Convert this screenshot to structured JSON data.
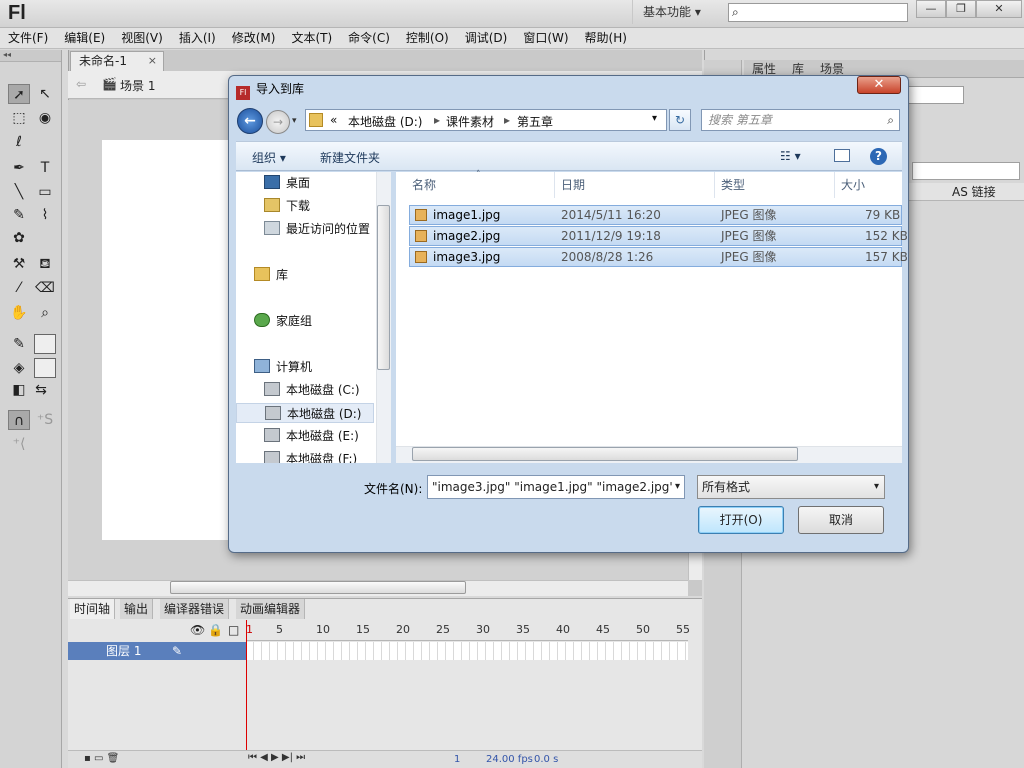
{
  "app": {
    "logo": "Fl",
    "workspace": "基本功能 ▾",
    "search_placeholder": "",
    "win_buttons": [
      "—",
      "❐",
      "✕"
    ]
  },
  "menu": [
    "文件(F)",
    "编辑(E)",
    "视图(V)",
    "插入(I)",
    "修改(M)",
    "文本(T)",
    "命令(C)",
    "控制(O)",
    "调试(D)",
    "窗口(W)",
    "帮助(H)"
  ],
  "document": {
    "tab_title": "未命名-1",
    "tab_close": "×",
    "scene": "场景 1"
  },
  "right_panel": {
    "tabs": [
      "属性",
      "库",
      "场景"
    ],
    "lib_column": "AS 链接"
  },
  "timeline": {
    "tabs": [
      "时间轴",
      "输出",
      "编译器错误",
      "动画编辑器"
    ],
    "ruler": [
      "1",
      "5",
      "10",
      "15",
      "20",
      "25",
      "30",
      "35",
      "40",
      "45",
      "50",
      "55"
    ],
    "layer_name": "图层 1",
    "frame_number": "1",
    "fps": "24.00 fps",
    "time": "0.0 s"
  },
  "dialog": {
    "title": "导入到库",
    "close": "✕",
    "address": [
      "«",
      "本地磁盘 (D:)",
      "▸",
      "课件素材",
      "▸",
      "第五章"
    ],
    "search_placeholder": "搜索 第五章",
    "toolbar": {
      "organize": "组织 ▾",
      "new_folder": "新建文件夹"
    },
    "nav_items": [
      {
        "label": "桌面",
        "icon": "desktop-icon"
      },
      {
        "label": "下载",
        "icon": "downloads-icon"
      },
      {
        "label": "最近访问的位置",
        "icon": "recent-places-icon"
      },
      {
        "label": "库",
        "icon": "libraries-icon"
      },
      {
        "label": "家庭组",
        "icon": "homegroup-icon"
      },
      {
        "label": "计算机",
        "icon": "computer-icon"
      },
      {
        "label": "本地磁盘 (C:)",
        "icon": "drive-icon"
      },
      {
        "label": "本地磁盘 (D:)",
        "icon": "drive-icon",
        "selected": true
      },
      {
        "label": "本地磁盘 (E:)",
        "icon": "drive-icon"
      },
      {
        "label": "本地磁盘 (F:)",
        "icon": "drive-icon"
      }
    ],
    "columns": [
      "名称",
      "日期",
      "类型",
      "大小"
    ],
    "files": [
      {
        "name": "image1.jpg",
        "date": "2014/5/11 16:20",
        "type": "JPEG 图像",
        "size": "79 KB"
      },
      {
        "name": "image2.jpg",
        "date": "2011/12/9 19:18",
        "type": "JPEG 图像",
        "size": "152 KB"
      },
      {
        "name": "image3.jpg",
        "date": "2008/8/28 1:26",
        "type": "JPEG 图像",
        "size": "157 KB"
      }
    ],
    "filename_label": "文件名(N):",
    "filename_value": "\"image3.jpg\" \"image1.jpg\" \"image2.jpg\"",
    "filetype": "所有格式",
    "open_button": "打开(O)",
    "cancel_button": "取消"
  }
}
